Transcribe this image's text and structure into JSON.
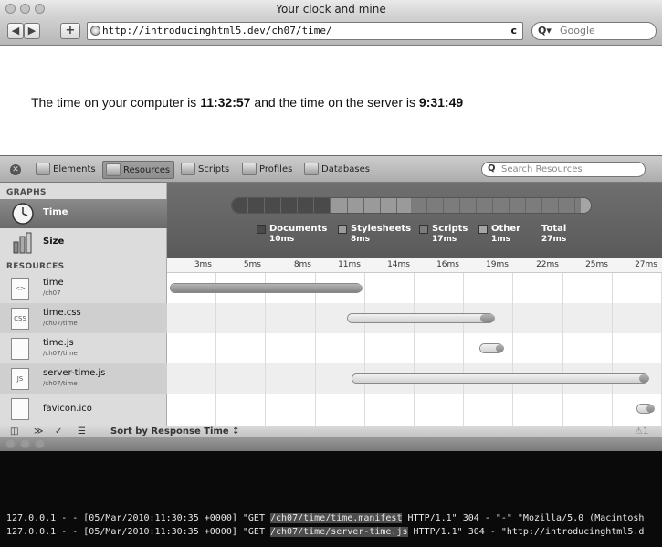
{
  "window": {
    "title": "Your clock and mine"
  },
  "browser": {
    "url": "http://introducinghtml5.dev/ch07/time/",
    "search_placeholder": "Google",
    "reload_glyph": "c"
  },
  "page": {
    "text_before": "The time on your computer is ",
    "local_time": "11:32:57",
    "text_mid": " and the time on the server is ",
    "server_time": "9:31:49"
  },
  "inspector": {
    "tabs": [
      {
        "label": "Elements",
        "icon": "elements-icon"
      },
      {
        "label": "Resources",
        "icon": "resources-icon"
      },
      {
        "label": "Scripts",
        "icon": "scripts-icon"
      },
      {
        "label": "Profiles",
        "icon": "profiles-icon"
      },
      {
        "label": "Databases",
        "icon": "databases-icon"
      }
    ],
    "active_tab": "Resources",
    "search_placeholder": "Search Resources",
    "sidebar": {
      "graphs_header": "GRAPHS",
      "graphs": [
        {
          "label": "Time",
          "icon": "clock-icon"
        },
        {
          "label": "Size",
          "icon": "size-icon"
        }
      ],
      "resources_header": "RESOURCES",
      "resources": [
        {
          "name": "time",
          "path": "/ch07",
          "type": "html-icon",
          "glyph": "<>"
        },
        {
          "name": "time.css",
          "path": "/ch07/time",
          "type": "css-icon",
          "glyph": "CSS"
        },
        {
          "name": "time.js",
          "path": "/ch07/time",
          "type": "js-file-icon",
          "glyph": ""
        },
        {
          "name": "server-time.js",
          "path": "/ch07/time",
          "type": "js-icon",
          "glyph": "JS"
        },
        {
          "name": "favicon.ico",
          "path": "",
          "type": "file-icon",
          "glyph": ""
        }
      ]
    },
    "legend": [
      {
        "label": "Documents",
        "value": "10ms",
        "color": "#4a4a4a"
      },
      {
        "label": "Stylesheets",
        "value": "8ms",
        "color": "#9a9a9a"
      },
      {
        "label": "Scripts",
        "value": "17ms",
        "color": "#7c7c7c"
      },
      {
        "label": "Other",
        "value": "1ms",
        "color": "#a5a5a5"
      },
      {
        "label": "Total",
        "value": "27ms",
        "color": ""
      }
    ],
    "summary": {
      "documents_ms": 10,
      "stylesheets_ms": 8,
      "scripts_ms": 17,
      "other_ms": 1,
      "total_ms": 27
    },
    "ticks": [
      "3ms",
      "5ms",
      "8ms",
      "11ms",
      "14ms",
      "16ms",
      "19ms",
      "22ms",
      "25ms",
      "27ms"
    ],
    "timeline": [
      {
        "start_ms": 0.0,
        "wait_end_ms": 0.0,
        "end_ms": 11.0
      },
      {
        "start_ms": 10.0,
        "wait_end_ms": 17.5,
        "end_ms": 18.5
      },
      {
        "start_ms": 17.5,
        "wait_end_ms": 18.4,
        "end_ms": 19.0
      },
      {
        "start_ms": 10.3,
        "wait_end_ms": 26.5,
        "end_ms": 27.2
      },
      {
        "start_ms": 26.4,
        "wait_end_ms": 26.9,
        "end_ms": 27.5
      }
    ],
    "timeline_max_ms": 28,
    "status": {
      "sort_label": "Sort by Response Time",
      "sort_arrow": "↕",
      "warning_count": "1",
      "warning_glyph": "⚠"
    }
  },
  "terminal": {
    "lines": [
      {
        "pre": "127.0.0.1 - - [05/Mar/2010:11:30:35 +0000] \"GET ",
        "hl": "/ch07/time/time.manifest",
        "post": " HTTP/1.1\" 304 - \"-\" \"Mozilla/5.0 (Macintosh"
      },
      {
        "pre": "127.0.0.1 - - [05/Mar/2010:11:30:35 +0000] \"GET ",
        "hl": "/ch07/time/server-time.js",
        "post": " HTTP/1.1\" 304 - \"http://introducinghtml5.d"
      }
    ]
  }
}
